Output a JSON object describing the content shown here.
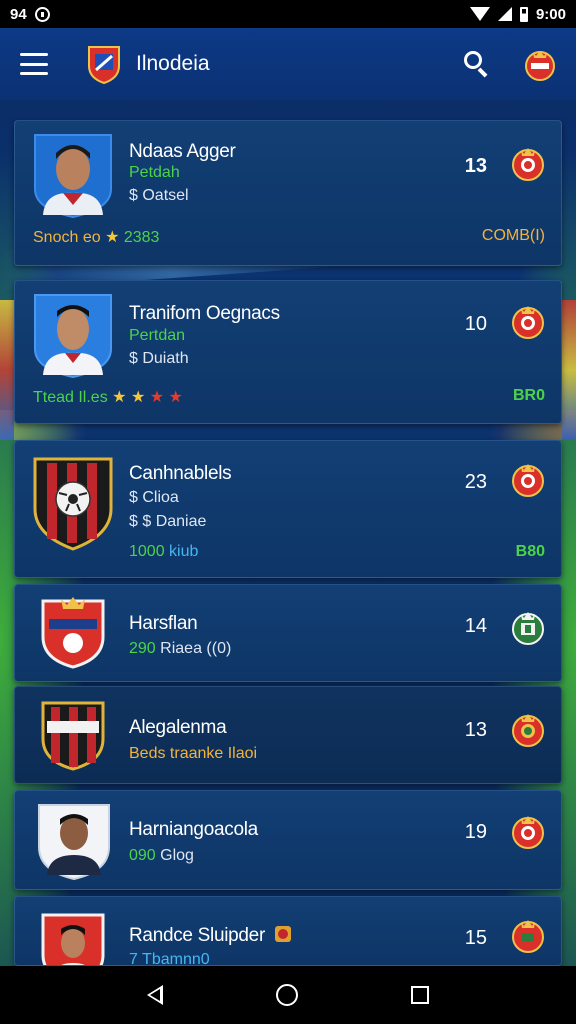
{
  "status_bar": {
    "left_text": "94",
    "time": "9:00"
  },
  "app_bar": {
    "title": "Ilnodeia"
  },
  "items": [
    {
      "name": "Ndaas Agger",
      "line1": "Petdah",
      "line2": "$ Oatsel",
      "number": "13",
      "footer_left": "Snoch eo",
      "footer_rating": "2383",
      "footer_right": "COMB(I)"
    },
    {
      "name": "Tranifom Oegnacs",
      "line1": "Pertdan",
      "line2": "$ Duiath",
      "number": "10",
      "footer_left": "Ttead Il.es",
      "footer_right": "BR0"
    },
    {
      "name": "Canhnablels",
      "line1": "$ Clioa",
      "line2": "$ $ Daniae",
      "line3a": "1000",
      "line3b": "kiub",
      "number": "23",
      "footer_right": "B80"
    },
    {
      "name": "Harsflan",
      "line1a": "290",
      "line1b": "Riaea ((0)",
      "number": "14"
    },
    {
      "name": "Alegalenma",
      "line1": "Beds traanke Ilaoi",
      "number": "13"
    },
    {
      "name": "Harniangoacola",
      "line1a": "090",
      "line1b": "Glog",
      "number": "19"
    },
    {
      "name": "Randce Sluipder",
      "line1": "7 Tbamnn0",
      "number": "15"
    }
  ],
  "colors": {
    "accent_green": "#4cd34a",
    "accent_gold": "#f4b43b",
    "badge_red": "#d9302a"
  },
  "icons": [
    "menu-icon",
    "search-icon",
    "club-crest-icon",
    "star-icon",
    "back-icon",
    "home-icon",
    "recents-icon"
  ]
}
